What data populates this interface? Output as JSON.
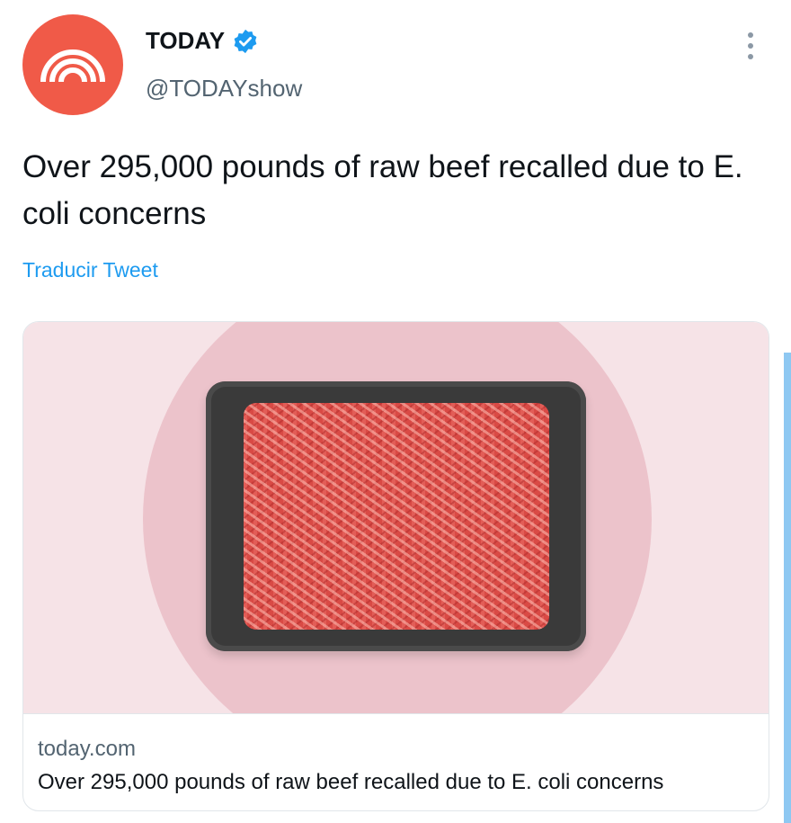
{
  "account": {
    "display_name": "TODAY",
    "handle": "@TODAYshow",
    "verified": true,
    "avatar_color": "#f05a48",
    "avatar_icon": "today-rainbow-logo"
  },
  "tweet": {
    "text": "Over 295,000 pounds of raw beef recalled due to E. coli concerns",
    "translate_label": "Traducir Tweet"
  },
  "link_card": {
    "image_icon": "ground-beef-tray",
    "domain": "today.com",
    "title": "Over 295,000 pounds of raw beef recalled due to E. coli concerns"
  },
  "colors": {
    "link_blue": "#1d9bf0",
    "text_primary": "#0f1419",
    "text_secondary": "#536471",
    "verified_blue": "#1d9bf0"
  }
}
